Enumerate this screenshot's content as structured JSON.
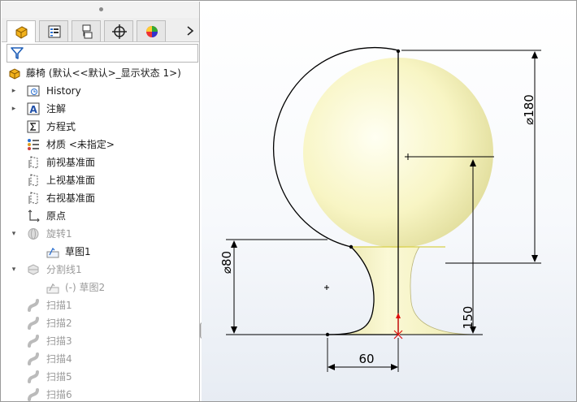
{
  "panel": {
    "tabs": [
      {
        "name": "featuremanager",
        "icon": "featuremanager-icon",
        "active": true
      },
      {
        "name": "propertymanager",
        "icon": "propertymanager-icon",
        "active": false
      },
      {
        "name": "configurationmanager",
        "icon": "configurationmanager-icon",
        "active": false
      },
      {
        "name": "dimxpertmanager",
        "icon": "dimxpert-icon",
        "active": false
      },
      {
        "name": "displaymanager",
        "icon": "displaymanager-icon",
        "active": false
      }
    ],
    "more_glyph": "›",
    "filter_icon": "filter-icon"
  },
  "tree": {
    "root": {
      "label": "藤椅  (默认<<默认>_显示状态 1>)",
      "icon": "part-icon"
    },
    "items": [
      {
        "label": "History",
        "icon": "history-folder-icon",
        "expander": "▸"
      },
      {
        "label": "注解",
        "icon": "annotations-icon",
        "expander": "▸"
      },
      {
        "label": "方程式",
        "icon": "equations-icon"
      },
      {
        "label": "材质 <未指定>",
        "icon": "material-icon"
      },
      {
        "label": "前视基准面",
        "icon": "plane-icon"
      },
      {
        "label": "上视基准面",
        "icon": "plane-icon"
      },
      {
        "label": "右视基准面",
        "icon": "plane-icon"
      },
      {
        "label": "原点",
        "icon": "origin-icon"
      },
      {
        "label": "旋转1",
        "icon": "revolve-icon",
        "expander": "▾",
        "dim": true
      },
      {
        "label": "草图1",
        "icon": "sketch-icon",
        "child": true
      },
      {
        "label": "分割线1",
        "icon": "splitline-icon",
        "expander": "▾",
        "dim": true
      },
      {
        "label": "(-) 草图2",
        "icon": "sketch-icon",
        "child": true,
        "dim": true
      },
      {
        "label": "扫描1",
        "icon": "sweep-icon",
        "dim": true
      },
      {
        "label": "扫描2",
        "icon": "sweep-icon",
        "dim": true
      },
      {
        "label": "扫描3",
        "icon": "sweep-icon",
        "dim": true
      },
      {
        "label": "扫描4",
        "icon": "sweep-icon",
        "dim": true
      },
      {
        "label": "扫描5",
        "icon": "sweep-icon",
        "dim": true
      },
      {
        "label": "扫描6",
        "icon": "sweep-icon",
        "dim": true
      }
    ]
  },
  "viewport": {
    "dimensions": {
      "sphere_diameter": "⌀180",
      "neck_diameter": "⌀80",
      "height": "150",
      "base_width": "60"
    },
    "colors": {
      "model_fill": "#f6f4c0",
      "model_shade": "#d8d48a",
      "dimension": "#000000",
      "origin": "#e01010"
    }
  }
}
